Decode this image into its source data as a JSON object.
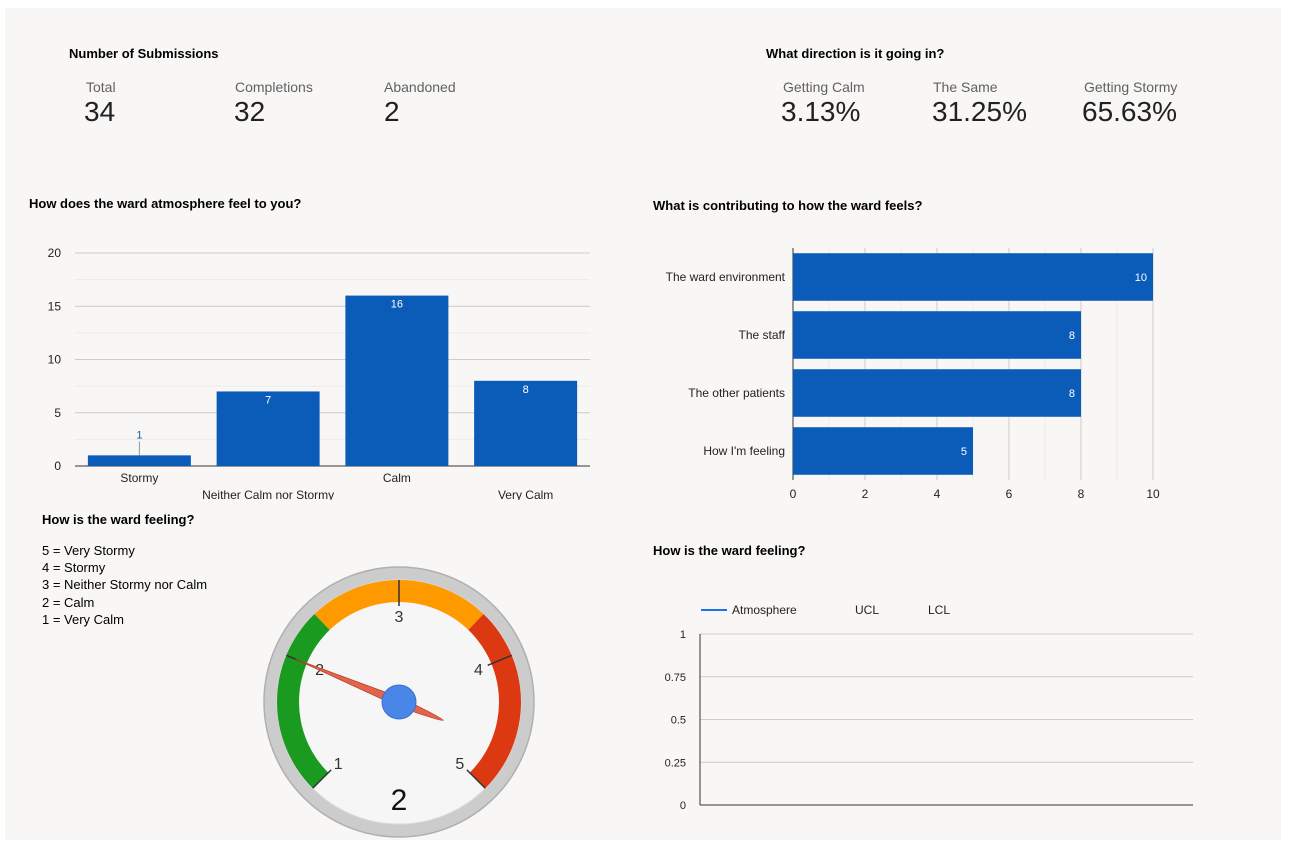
{
  "submissions": {
    "title": "Number of Submissions",
    "kpis": [
      {
        "label": "Total",
        "value": "34"
      },
      {
        "label": "Completions",
        "value": "32"
      },
      {
        "label": "Abandoned",
        "value": "2"
      }
    ]
  },
  "direction": {
    "title": "What direction is it going in?",
    "kpis": [
      {
        "label": "Getting Calm",
        "value": "3.13%"
      },
      {
        "label": "The Same",
        "value": "31.25%"
      },
      {
        "label": "Getting Stormy",
        "value": "65.63%"
      }
    ]
  },
  "gauge_panel": {
    "title": "How is the ward feeling?",
    "scale_legend": [
      "5 = Very Stormy",
      "4 = Stormy",
      "3 = Neither Stormy nor Calm",
      "2 = Calm",
      "1 = Very Calm"
    ]
  },
  "colors": {
    "bar": "#0b5cb8",
    "gauge_green": "#1a9a1f",
    "gauge_orange": "#ff9900",
    "gauge_red": "#dc3912",
    "needle": "#e2644a",
    "hub": "#4a86e8",
    "line_series": "#1a73e8"
  },
  "chart_data": [
    {
      "type": "bar",
      "title": "How does the ward atmosphere feel to you?",
      "categories": [
        "Stormy",
        "Neither Calm nor Stormy",
        "Calm",
        "Very Calm"
      ],
      "values": [
        1,
        7,
        16,
        8
      ],
      "ylim": [
        0,
        20
      ],
      "yticks": [
        0,
        5,
        10,
        15,
        20
      ],
      "grid": true
    },
    {
      "type": "bar",
      "orientation": "horizontal",
      "title": "What is contributing to how the ward feels?",
      "categories": [
        "The ward environment",
        "The staff",
        "The other patients",
        "How I'm feeling"
      ],
      "values": [
        10,
        8,
        8,
        5
      ],
      "xlim": [
        0,
        10
      ],
      "xticks": [
        0,
        2,
        4,
        6,
        8,
        10
      ],
      "grid": true
    },
    {
      "type": "gauge",
      "min": 1,
      "max": 5,
      "value": 2,
      "ticks": [
        1,
        2,
        3,
        4,
        5
      ],
      "bands": [
        {
          "from": 1,
          "to": 2.35,
          "color": "green"
        },
        {
          "from": 2.35,
          "to": 3.65,
          "color": "orange"
        },
        {
          "from": 3.65,
          "to": 5,
          "color": "red"
        }
      ],
      "value_label": "2"
    },
    {
      "type": "line",
      "title": "How is the ward feeling?",
      "series": [
        {
          "name": "Atmosphere",
          "values": []
        },
        {
          "name": "UCL",
          "values": []
        },
        {
          "name": "LCL",
          "values": []
        }
      ],
      "ylim": [
        0,
        1
      ],
      "yticks": [
        "0",
        "0.25",
        "0.5",
        "0.75",
        "1"
      ],
      "legend": "top-left",
      "grid": true
    }
  ]
}
